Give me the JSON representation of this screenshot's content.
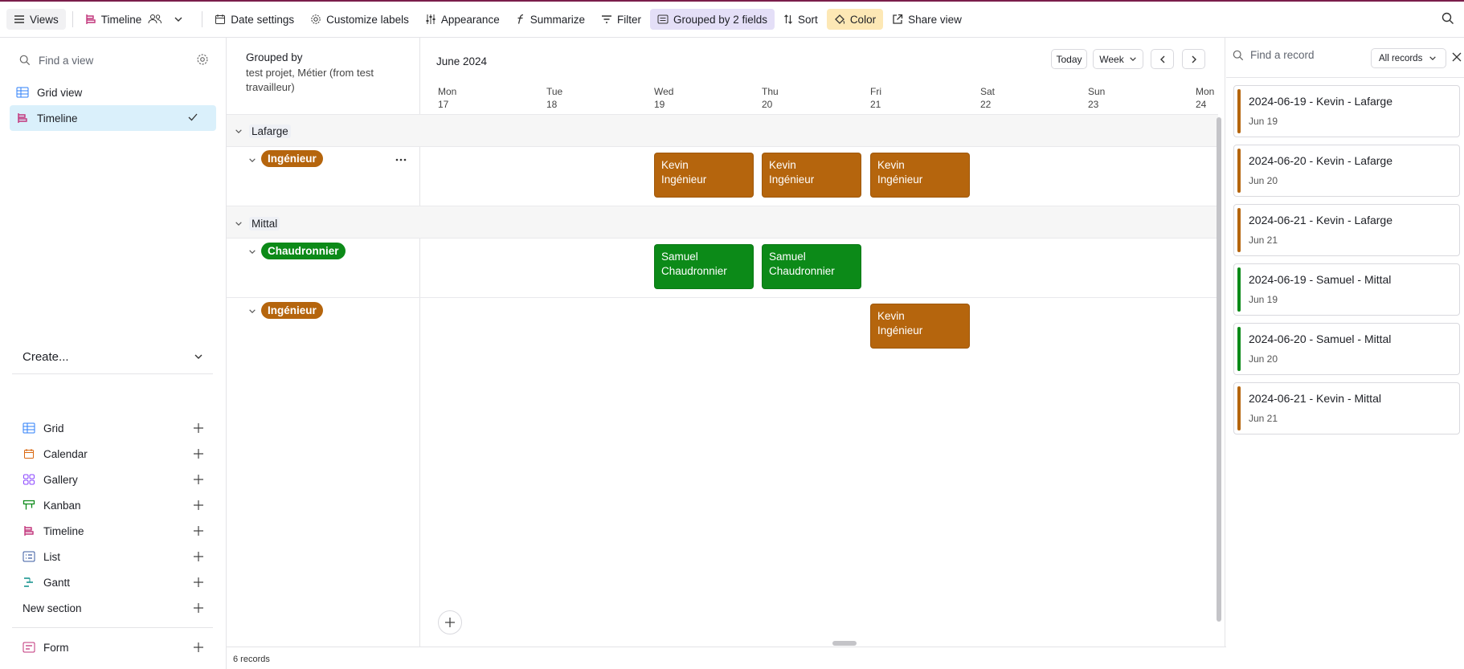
{
  "toolbar": {
    "views_label": "Views",
    "timeline_label": "Timeline",
    "date_settings": "Date settings",
    "customize_labels": "Customize labels",
    "appearance": "Appearance",
    "summarize": "Summarize",
    "filter": "Filter",
    "grouped": "Grouped by 2 fields",
    "sort": "Sort",
    "color": "Color",
    "share_view": "Share view"
  },
  "sidebar": {
    "find_placeholder": "Find a view",
    "views": [
      {
        "label": "Grid view",
        "icon": "grid-icon",
        "active": false
      },
      {
        "label": "Timeline",
        "icon": "timeline-icon",
        "active": true
      }
    ],
    "create_title": "Create...",
    "create_items": [
      {
        "label": "Grid",
        "icon": "grid-icon"
      },
      {
        "label": "Calendar",
        "icon": "calendar-icon"
      },
      {
        "label": "Gallery",
        "icon": "gallery-icon"
      },
      {
        "label": "Kanban",
        "icon": "kanban-icon"
      },
      {
        "label": "Timeline",
        "icon": "timeline-icon"
      },
      {
        "label": "List",
        "icon": "list-icon"
      },
      {
        "label": "Gantt",
        "icon": "gantt-icon"
      },
      {
        "label": "New section",
        "icon": ""
      }
    ],
    "form_label": "Form"
  },
  "grouping": {
    "title": "Grouped by",
    "fields": "test projet, Métier (from test travailleur)"
  },
  "calendar": {
    "month": "June 2024",
    "today": "Today",
    "range": "Week",
    "days": [
      {
        "name": "Mon",
        "num": "17"
      },
      {
        "name": "Tue",
        "num": "18"
      },
      {
        "name": "Wed",
        "num": "19"
      },
      {
        "name": "Thu",
        "num": "20"
      },
      {
        "name": "Fri",
        "num": "21"
      },
      {
        "name": "Sat",
        "num": "22"
      },
      {
        "name": "Sun",
        "num": "23"
      },
      {
        "name": "Mon",
        "num": "24"
      }
    ]
  },
  "groups": [
    {
      "label": "Lafarge",
      "subgroups": [
        {
          "label": "Ingénieur",
          "color": "#b5650d",
          "events": [
            {
              "name": "Kevin",
              "role": "Ingénieur",
              "day": "Wed 19"
            },
            {
              "name": "Kevin",
              "role": "Ingénieur",
              "day": "Thu 20"
            },
            {
              "name": "Kevin",
              "role": "Ingénieur",
              "day": "Fri 21"
            }
          ]
        }
      ]
    },
    {
      "label": "Mittal",
      "subgroups": [
        {
          "label": "Chaudronnier",
          "color": "#0c8a18",
          "events": [
            {
              "name": "Samuel",
              "role": "Chaudronnier",
              "day": "Wed 19"
            },
            {
              "name": "Samuel",
              "role": "Chaudronnier",
              "day": "Thu 20"
            }
          ]
        },
        {
          "label": "Ingénieur",
          "color": "#b5650d",
          "events": [
            {
              "name": "Kevin",
              "role": "Ingénieur",
              "day": "Fri 21"
            }
          ]
        }
      ]
    }
  ],
  "footer": {
    "records": "6 records"
  },
  "records_panel": {
    "find_placeholder": "Find a record",
    "filter_label": "All records",
    "records": [
      {
        "title": "2024-06-19 - Kevin - Lafarge",
        "date": "Jun 19",
        "color": "#b5650d"
      },
      {
        "title": "2024-06-20 - Kevin - Lafarge",
        "date": "Jun 20",
        "color": "#b5650d"
      },
      {
        "title": "2024-06-21 - Kevin - Lafarge",
        "date": "Jun 21",
        "color": "#b5650d"
      },
      {
        "title": "2024-06-19 - Samuel - Mittal",
        "date": "Jun 19",
        "color": "#0c8a18"
      },
      {
        "title": "2024-06-20 - Samuel - Mittal",
        "date": "Jun 20",
        "color": "#0c8a18"
      },
      {
        "title": "2024-06-21 - Kevin - Mittal",
        "date": "Jun 21",
        "color": "#b5650d"
      }
    ]
  }
}
